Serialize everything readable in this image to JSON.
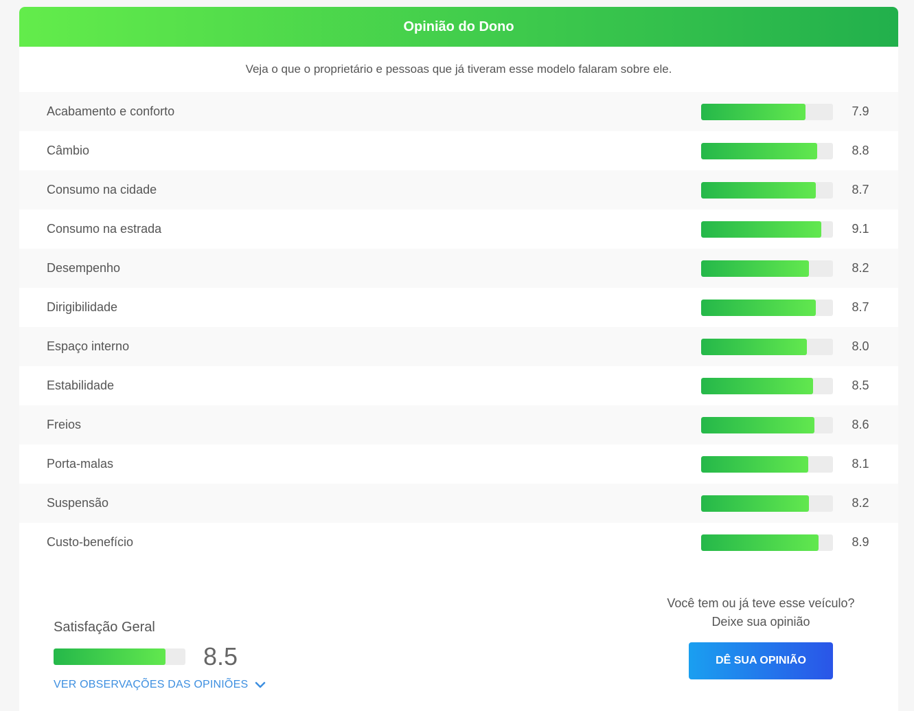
{
  "header": {
    "title": "Opinião do Dono"
  },
  "subtitle": "Veja o que o proprietário e pessoas que já tiveram esse modelo falaram sobre ele.",
  "ratings": [
    {
      "label": "Acabamento e conforto",
      "value": "7.9",
      "score": 7.9
    },
    {
      "label": "Câmbio",
      "value": "8.8",
      "score": 8.8
    },
    {
      "label": "Consumo na cidade",
      "value": "8.7",
      "score": 8.7
    },
    {
      "label": "Consumo na estrada",
      "value": "9.1",
      "score": 9.1
    },
    {
      "label": "Desempenho",
      "value": "8.2",
      "score": 8.2
    },
    {
      "label": "Dirigibilidade",
      "value": "8.7",
      "score": 8.7
    },
    {
      "label": "Espaço interno",
      "value": "8.0",
      "score": 8.0
    },
    {
      "label": "Estabilidade",
      "value": "8.5",
      "score": 8.5
    },
    {
      "label": "Freios",
      "value": "8.6",
      "score": 8.6
    },
    {
      "label": "Porta-malas",
      "value": "8.1",
      "score": 8.1
    },
    {
      "label": "Suspensão",
      "value": "8.2",
      "score": 8.2
    },
    {
      "label": "Custo-benefício",
      "value": "8.9",
      "score": 8.9
    }
  ],
  "summary": {
    "title": "Satisfação Geral",
    "value": "8.5",
    "score": 8.5
  },
  "observations_link": {
    "label": "VER OBSERVAÇÕES DAS OPINIÕES",
    "icon": "chevron-down-icon"
  },
  "cta": {
    "question": "Você tem ou já teve esse veículo?",
    "sub": "Deixe sua opinião",
    "button_label": "DÊ SUA OPINIÃO"
  },
  "colors": {
    "header_gradient_start": "#63ec4b",
    "header_gradient_end": "#22b04c",
    "bar_fill_start": "#25b84a",
    "bar_fill_end": "#62e84e",
    "bar_track": "#ececec",
    "link": "#3d8fe0",
    "button_gradient_start": "#1a9ff0",
    "button_gradient_end": "#2a55e8"
  }
}
